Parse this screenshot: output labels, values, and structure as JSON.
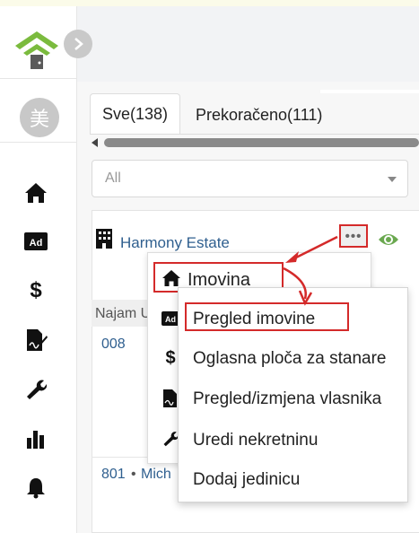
{
  "sidebar": {
    "avatar_text": "美",
    "nav": [
      {
        "icon": "home-icon"
      },
      {
        "icon": "ad-icon",
        "label": "Ad"
      },
      {
        "icon": "dollar-icon",
        "label": "$"
      },
      {
        "icon": "document-signature-icon"
      },
      {
        "icon": "wrench-icon"
      },
      {
        "icon": "bar-chart-icon"
      },
      {
        "icon": "bell-icon"
      }
    ]
  },
  "tabs": [
    {
      "label": "Sve(138)",
      "active": true
    },
    {
      "label": "Prekoračeno(111)",
      "active": false
    }
  ],
  "filter": {
    "selected": "All"
  },
  "card": {
    "title": "Harmony Estate",
    "more_label": "•••",
    "list_header": "Najam U",
    "rows": [
      {
        "number": "008"
      },
      {
        "number": "801",
        "bullet": "•",
        "name": "Mich"
      }
    ]
  },
  "menu": {
    "header_label": "Imovina",
    "side_icons": [
      "ad-icon",
      "dollar-icon",
      "document-signature-icon",
      "wrench-icon"
    ],
    "side_labels": [
      "Ad",
      "$"
    ]
  },
  "submenu": {
    "items": [
      "Pregled imovine",
      "Oglasna ploča za stanare",
      "Pregled/izmjena vlasnika",
      "Uredi nekretninu",
      "Dodaj jedinicu"
    ]
  },
  "colors": {
    "accent_green": "#6aa84f",
    "link_blue": "#2f5f8f",
    "highlight_red": "#d42a2a"
  }
}
